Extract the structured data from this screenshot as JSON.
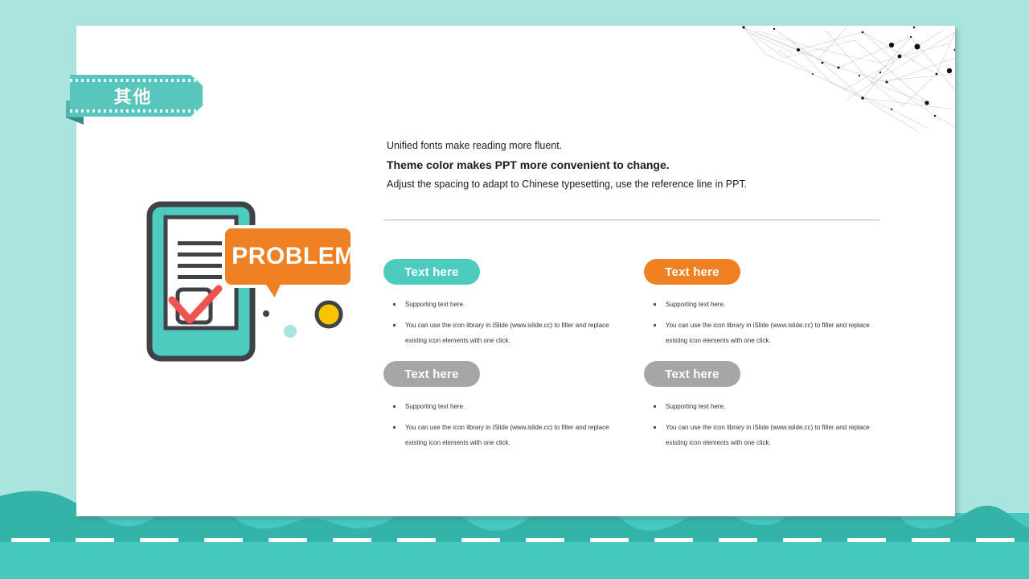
{
  "theme": {
    "background": "#a9e4df",
    "card_background": "#ffffff",
    "accent_teal": "#4ecbbf",
    "accent_orange": "#ef8024",
    "accent_gray": "#a6a6a6",
    "mountain_dark": "#34b3a9",
    "band_light": "#45c9be",
    "ribbon": "#58c6bd"
  },
  "ribbon": {
    "title": "其他"
  },
  "intro": {
    "line1": "Unified fonts make reading more fluent.",
    "line2": "Theme color makes PPT more convenient to change.",
    "line3": "Adjust the spacing to adapt to Chinese typesetting, use the reference line in PPT."
  },
  "blocks": [
    {
      "label": "Text here",
      "color": "teal",
      "bullets": [
        "Supporting text here.",
        "You can use the icon library in iSlide  (www.islide.cc) to filter and replace existing icon elements with one click."
      ]
    },
    {
      "label": "Text here",
      "color": "orange",
      "bullets": [
        "Supporting text here.",
        "You can use the icon library in iSlide (www.islide.cc) to filter and replace existing icon elements with one click."
      ]
    },
    {
      "label": "Text here",
      "color": "gray",
      "bullets": [
        "Supporting text here.",
        "You can use the icon library in iSlide  (www.islide.cc) to filter and replace existing icon elements with one click."
      ]
    },
    {
      "label": "Text here",
      "color": "gray",
      "bullets": [
        "Supporting text here.",
        "You can use the icon library in iSlide (www.islide.cc) to filter and replace existing icon elements with one click."
      ]
    }
  ],
  "illustration": {
    "speech_bubble_text": "PROBLEM",
    "clipboard_color": "#4ecbbf",
    "bubble_color": "#ef8024",
    "check_color": "#ef5350",
    "dot_yellow": "#fbc400",
    "outline": "#3f4345"
  },
  "decor": {
    "network_name": "network-constellation",
    "mountains_name": "mountain-silhouette",
    "road_dashes": 16
  }
}
